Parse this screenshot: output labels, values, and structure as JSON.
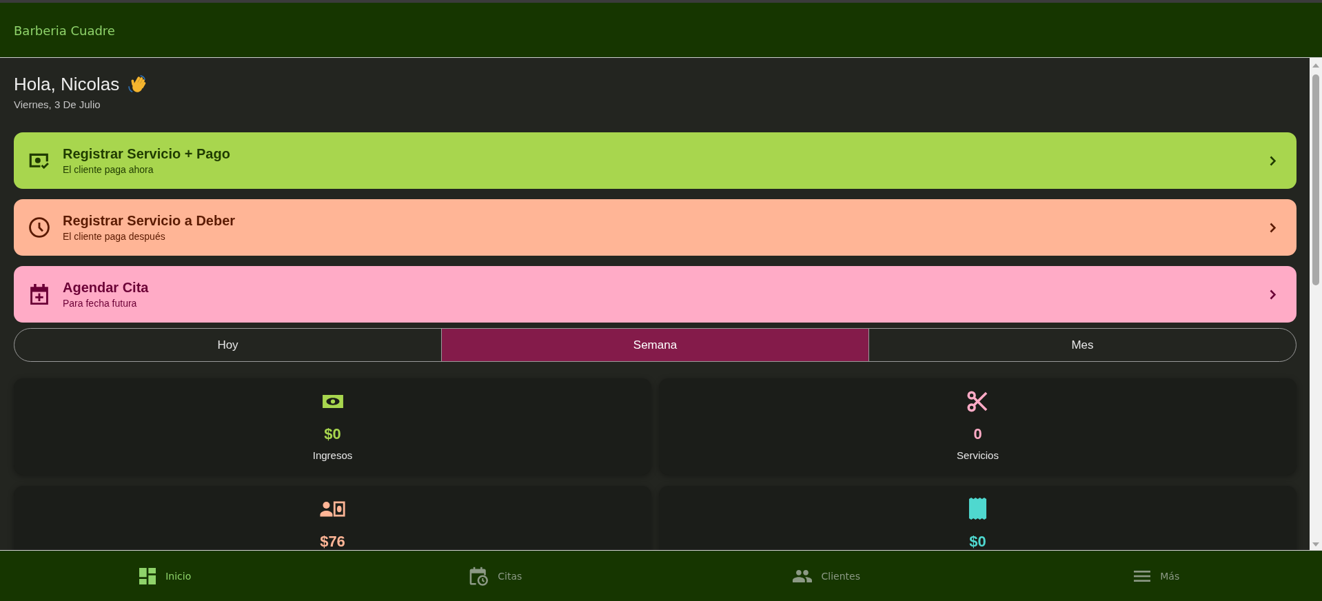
{
  "app_bar": {
    "title": "Barberia Cuadre"
  },
  "greeting": {
    "text": "Hola, Nicolas",
    "date": "Viernes, 3 De Julio"
  },
  "actions": [
    {
      "kind": "paid_now",
      "title": "Registrar Servicio + Pago",
      "subtitle": "El cliente paga ahora",
      "color": "#a8d64e"
    },
    {
      "kind": "pay_later",
      "title": "Registrar Servicio a Deber",
      "subtitle": "El cliente paga después",
      "color": "#ffb596"
    },
    {
      "kind": "appointment",
      "title": "Agendar Cita",
      "subtitle": "Para fecha futura",
      "color": "#ffabc6"
    }
  ],
  "period_tabs": [
    {
      "label": "Hoy",
      "selected": false
    },
    {
      "label": "Semana",
      "selected": true
    },
    {
      "label": "Mes",
      "selected": false
    }
  ],
  "stats": [
    {
      "kind": "income",
      "value": "$0",
      "label": "Ingresos",
      "color": "#a8d64e"
    },
    {
      "kind": "services",
      "value": "0",
      "label": "Servicios",
      "color": "#ffabc6"
    },
    {
      "kind": "debts",
      "value": "$76",
      "color": "#ffb596"
    },
    {
      "kind": "receipts",
      "value": "$0",
      "color": "#4fd8cf"
    }
  ],
  "bottom_nav": [
    {
      "kind": "dashboard",
      "label": "Inicio",
      "selected": true
    },
    {
      "kind": "appointments",
      "label": "Citas",
      "selected": false
    },
    {
      "kind": "clients",
      "label": "Clientes",
      "selected": false
    },
    {
      "kind": "more",
      "label": "Más",
      "selected": false
    }
  ]
}
